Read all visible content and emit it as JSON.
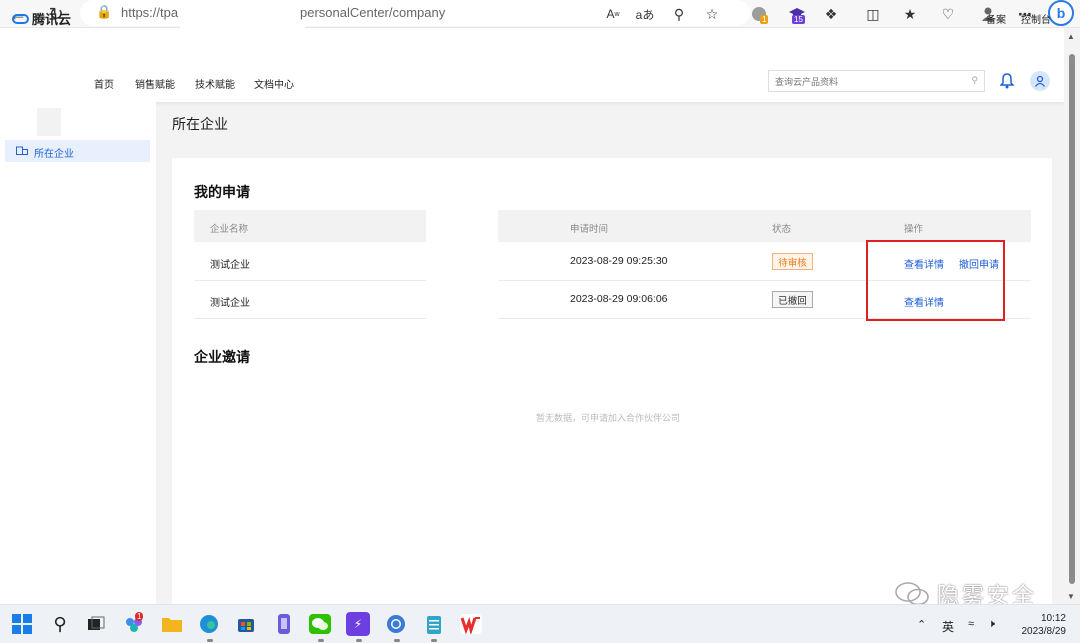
{
  "browser": {
    "url_start": "https://tpa",
    "url_end": "personalCenter/company",
    "toolbar_badges": {
      "ext1": "1",
      "ext2": "15"
    }
  },
  "site": {
    "logo_text": "腾讯云",
    "top_links": [
      "备案",
      "控制台"
    ],
    "nav": [
      "首页",
      "销售赋能",
      "技术赋能",
      "文档中心"
    ],
    "search_placeholder": "查询云产品资料"
  },
  "sidebar": {
    "active_item_label": "所在企业"
  },
  "page": {
    "title": "所在企业",
    "my_applications": {
      "title": "我的申请",
      "columns": [
        "企业名称",
        "申请时间",
        "状态",
        "操作"
      ],
      "rows": [
        {
          "name": "测试企业",
          "time": "2023-08-29 09:25:30",
          "status": "待审核",
          "actions": [
            "查看详情",
            "撤回申请"
          ]
        },
        {
          "name": "测试企业",
          "time": "2023-08-29 09:06:06",
          "status": "已撤回",
          "actions": [
            "查看详情"
          ]
        }
      ]
    },
    "invitations": {
      "title": "企业邀请",
      "empty_text": "暂无数据，可申请加入合作伙伴公司"
    }
  },
  "watermark": {
    "text": "隐雾安全"
  },
  "taskbar": {
    "notification_badge": "1",
    "ime": "英",
    "time": "10:12",
    "date": "2023/8/29"
  },
  "colors": {
    "accent": "#1a5ed6",
    "pending": "#f07b1d",
    "highlight_box": "#e02020"
  }
}
